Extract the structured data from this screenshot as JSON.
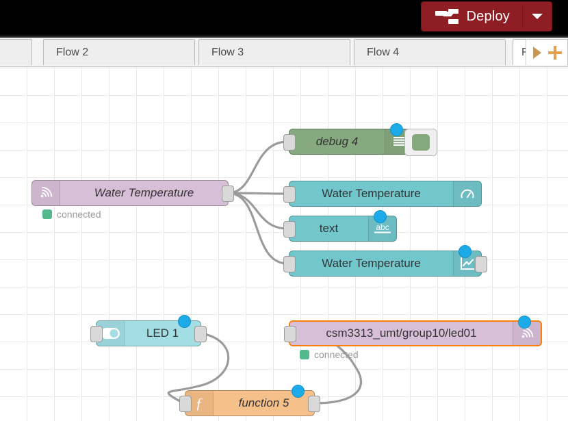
{
  "header": {
    "deploy_label": "Deploy",
    "deploy_icon": "deploy-flow-icon",
    "caret_icon": "chevron-down-icon",
    "deploy_color": "#8e1e24"
  },
  "tabs": {
    "items": [
      {
        "label": "",
        "name": "tab-partial-left"
      },
      {
        "label": "Flow 2",
        "name": "tab-flow-2"
      },
      {
        "label": "Flow 3",
        "name": "tab-flow-3"
      },
      {
        "label": "Flow 4",
        "name": "tab-flow-4"
      },
      {
        "label": "F",
        "name": "tab-flow-5-active"
      }
    ],
    "next_icon": "arrow-right-icon",
    "add_icon": "plus-icon"
  },
  "canvas": {
    "nodes": [
      {
        "id": "mqtt-in-water-temperature",
        "label": "Water Temperature",
        "type": "mqtt-in",
        "icon": "mqtt-antenna-icon",
        "status": "connected",
        "color": "#d8bfd8"
      },
      {
        "id": "debug-4",
        "label": "debug 4",
        "type": "debug",
        "icon": "debug-lines-icon",
        "color": "#87a980"
      },
      {
        "id": "gauge-water-temperature",
        "label": "Water Temperature",
        "type": "ui-gauge",
        "icon": "gauge-icon",
        "color": "#72c7cd"
      },
      {
        "id": "text-node",
        "label": "text",
        "type": "ui-text",
        "icon": "abc-icon",
        "color": "#72c7cd"
      },
      {
        "id": "chart-water-temperature",
        "label": "Water Temperature",
        "type": "ui-chart",
        "icon": "line-chart-icon",
        "color": "#72c7cd"
      },
      {
        "id": "led-1",
        "label": "LED 1",
        "type": "ui-switch",
        "icon": "toggle-switch-icon",
        "color": "#a2dee4"
      },
      {
        "id": "mqtt-out-led01",
        "label": "csm3313_umt/group10/led01",
        "type": "mqtt-out",
        "icon": "mqtt-antenna-icon",
        "status": "connected",
        "selected": true,
        "color": "#d8bfd8"
      },
      {
        "id": "function-5",
        "label": "function 5",
        "type": "function",
        "icon": "function-f-icon",
        "color": "#f6c08a"
      }
    ],
    "status_connected_label": "connected",
    "status_color": "#53b88e",
    "selection_color": "#ff7f0e",
    "badge_color": "#1cabe8",
    "wire_color": "#9b9b9b"
  }
}
